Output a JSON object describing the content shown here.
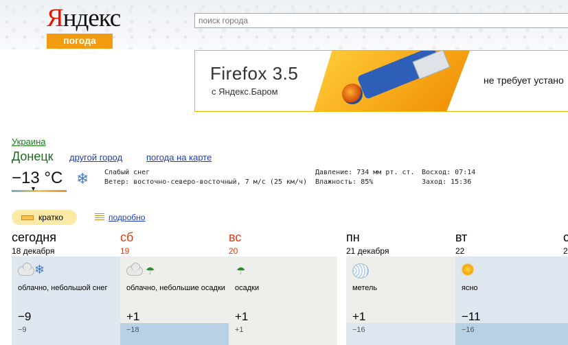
{
  "header": {
    "logo_text": "Яндекс",
    "logo_badge": "погода",
    "search_placeholder": "поиск города"
  },
  "banner": {
    "title": "Firefox 3.5",
    "subtitle": "с Яндекс.Баром",
    "tagline": "не требует устано"
  },
  "location": {
    "country": "Украина",
    "city": "Донецк",
    "other_city_link": "другой город",
    "map_link": "погода на карте"
  },
  "current": {
    "temperature": "−13 °C",
    "condition": "Слабый снег",
    "wind": "Ветер: восточно-северо-восточный, 7 м/с (25 км/ч)",
    "pressure": "Давление: 734 мм рт. ст.",
    "humidity": "Влажность: 85%",
    "sunrise": "Восход: 07:14",
    "sunset": "Заход: 15:36"
  },
  "view_tabs": {
    "short": "кратко",
    "detailed": "подробно"
  },
  "forecast": [
    {
      "name": "сегодня",
      "date": "18 декабря",
      "weekend": false,
      "condition": "облачно, небольшой снег",
      "day_temp": "−9",
      "night_temp": "−9",
      "icons": [
        "cloud-icon",
        "snowflake-icon"
      ]
    },
    {
      "name": "сб",
      "date": "19",
      "weekend": true,
      "condition": "облачно, небольшие осадки",
      "day_temp": "+1",
      "night_temp": "−18",
      "icons": [
        "cloud-icon",
        "umbrella-icon"
      ]
    },
    {
      "name": "вс",
      "date": "20",
      "weekend": true,
      "condition": "осадки",
      "day_temp": "+1",
      "night_temp": "+1",
      "icons": [
        "umbrella-icon"
      ]
    },
    {
      "name": "пн",
      "date": "21 декабря",
      "weekend": false,
      "condition": "метель",
      "day_temp": "+1",
      "night_temp": "−16",
      "icons": [
        "blizzard-icon"
      ]
    },
    {
      "name": "вт",
      "date": "22",
      "weekend": false,
      "condition": "ясно",
      "day_temp": "−11",
      "night_temp": "−16",
      "icons": [
        "sun-icon"
      ]
    },
    {
      "name": "с",
      "date": "2",
      "weekend": false
    }
  ],
  "colors": {
    "weekend": "#e23a0f",
    "day_bg": "#dfe8f0",
    "day_bg_alt": "#eeeeea",
    "night_band": "#b9d1e4",
    "link": "#1a3dc1",
    "brand_orange": "#f39c12"
  }
}
